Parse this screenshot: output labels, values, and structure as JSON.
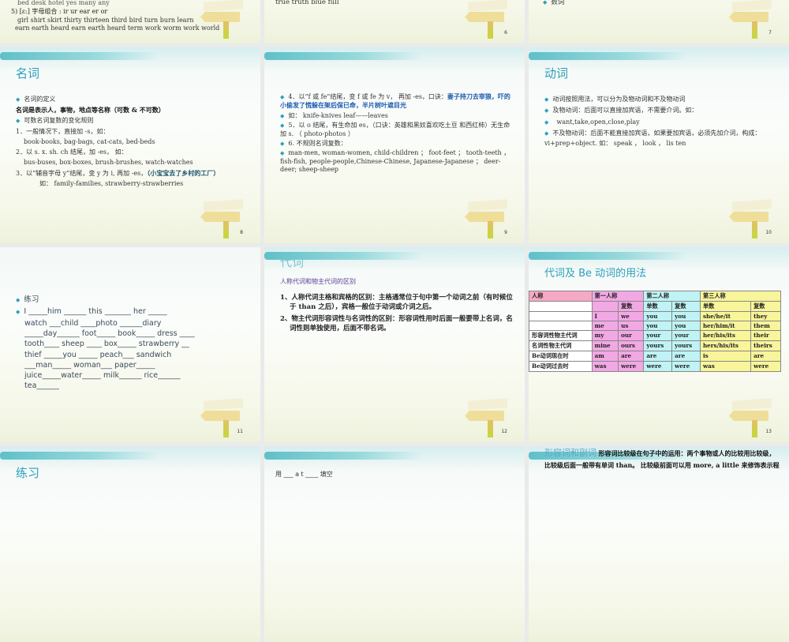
{
  "slides": [
    {
      "page": "",
      "lines": [
        "bed   desk   hotel  yes many  any",
        "5) [ɛ:]  字母组合  : ir  ur  ear er   or",
        "girl  shirt  skirt thirty thirteen third  bird   turn  burn  learn",
        "earn  earth  heard earn  earth  heard  term   work  worm  work  world"
      ]
    },
    {
      "page": "6",
      "lines": [
        "true    truth   blue   full"
      ]
    },
    {
      "page": "7",
      "lines": [
        "数词"
      ]
    },
    {
      "page": "8",
      "title": "名词",
      "lines": [
        "名词的定义",
        "名词是表示人，事物，地点等名称（可数 & 不可数）",
        "可数名词复数的变化规则",
        "1．一般情况下，直接加 -s，如：",
        "book-books, bag-bags, cat-cats, bed-beds",
        "2．以 s. x. sh. ch 结尾，加 -es，  如：",
        "bus-buses, box-boxes, brush-brushes, watch-watches",
        "3．以“辅音字母  y”结尾，变 y 为 i, 再加 -es，",
        "（小宝宝去了乡村的工厂）",
        "如： family-families, strawberry-strawberries"
      ]
    },
    {
      "page": "9",
      "lines": [
        "4．以“f 或 fe”结尾，变 f 或 fe 为 v， 再加 -es，口诀：",
        "妻子持刀去宰狼，吓的小偷发了慌躲在架后保已命，半片树叶遮目光",
        "如： knife-knives      leaf——leaves",
        "5．以 o 结尾，有生命加 es，（口诀：英雄和黑奴喜欢吃土豆 和西红柿）无生命加 s. （ photo-photos ）",
        "6. 不规则名词复数：",
        "man-men, woman-women, child-children ；  foot-feet ； tooth-teeth ，  fish-fish, people-people,Chinese-Chinese, Japanese-Japanese ；  deer-deer; sheep-sheep"
      ]
    },
    {
      "page": "10",
      "title": "动词",
      "lines": [
        "动词按照用法，可以分为及物动词和不及物动词",
        "及物动词：后面可以直接加宾语，不需要介词。如：",
        "want,take,open,close,play",
        "不及物动词：后面不能直接加宾语，如果要加宾语，必须先加介词，构成： vi+prep+object. 如： speak ， look ， lis ten"
      ]
    },
    {
      "page": "11",
      "lines": [
        "练习",
        "I _____him ______    this _______ her _____",
        "watch ___child ____photo ______diary",
        "_____day______ foot_____ book_____   dress ____",
        "tooth____ sheep ____ box_____ strawberry __",
        "thief _____you _____ peach___  sandwich",
        "___man_____ woman___ paper_____",
        "juice_____water_____ milk______ rice______",
        "tea______"
      ]
    },
    {
      "page": "12",
      "title": "代词",
      "lines": [
        "人称代词和物主代词的区别",
        "1、人称代词主格和宾格的区别：主格通常位于句中第一个动词之前（有时候位于 than  之后），宾格一般位于动词或介词之后。",
        "2、物主代词形容词性与名词性的区别：形容词性用时后面一般要带上名词，名词性则单独使用，后面不带名词。"
      ]
    },
    {
      "page": "13",
      "title": "代词及 Be 动词的用法",
      "table": {
        "header": [
          "人称",
          "第一人称",
          "第二人称",
          "第三人称"
        ],
        "sub": [
          "",
          "",
          "复数",
          "单数",
          "复数",
          "单数",
          "复数"
        ],
        "rows": [
          [
            "",
            "I",
            "we",
            "you",
            "you",
            "she/he/it",
            "they"
          ],
          [
            "",
            "me",
            "us",
            "you",
            "you",
            "her/him/it",
            "them"
          ],
          [
            "形容词性物主代词",
            "my",
            "our",
            "your",
            "your",
            "her/his/its",
            "their"
          ],
          [
            "名词性物主代词",
            "mine",
            "ours",
            "yours",
            "yours",
            "hers/his/its",
            "theirs"
          ],
          [
            "Be动词现在时",
            "am",
            "are",
            "are",
            "are",
            "is",
            "are"
          ],
          [
            "Be动词过去时",
            "was",
            "were",
            "were",
            "were",
            "was",
            "were"
          ]
        ]
      }
    },
    {
      "page": "",
      "title": "练习"
    },
    {
      "page": "",
      "lines": [
        "用 ___ a  t ____ 填空"
      ]
    },
    {
      "page": "",
      "title": "形容词和副词",
      "lines": [
        "形容词比较级在句子中的运用：两个事物或人的比较用比较级，比较级后面一般带有单词 than。",
        "比较级前面可以用 more, a little 来修饰表示程"
      ]
    }
  ],
  "colors": {
    "title": "#2aa0bd",
    "first_person": "#f2a8e4",
    "second_person": "#bff3f5",
    "third_person": "#f8f59a",
    "header_person": "#f7a8c4"
  }
}
